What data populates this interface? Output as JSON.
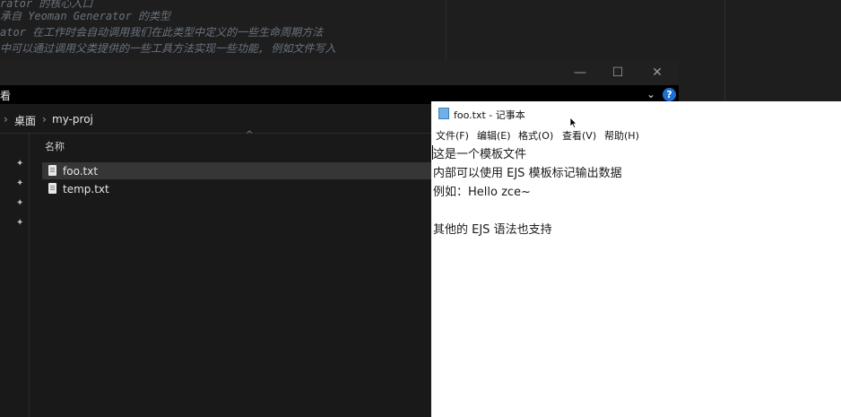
{
  "editor": {
    "lines": [
      "rator 的核心入口",
      "承自 Yeoman Generator 的类型",
      "ator 在工作时会自动调用我们在此类型中定义的一些生命周期方法",
      "中可以通过调用父类提供的一些工具方法实现一些功能, 例如文件写入"
    ]
  },
  "explorer": {
    "window_controls": {
      "minimize": "—",
      "maximize": "☐",
      "close": "✕"
    },
    "ribbon": {
      "label": "看",
      "expand": "⌄",
      "help": "?"
    },
    "breadcrumb": {
      "sep": "›",
      "items": [
        "桌面",
        "my-proj"
      ]
    },
    "columns": {
      "name": "名称",
      "sort": "^"
    },
    "files": [
      {
        "name": "foo.txt",
        "selected": true
      },
      {
        "name": "temp.txt",
        "selected": false
      }
    ],
    "pin_glyph": "✦"
  },
  "notepad": {
    "title": "foo.txt - 记事本",
    "menu": [
      "文件(F)",
      "编辑(E)",
      "格式(O)",
      "查看(V)",
      "帮助(H)"
    ],
    "content": [
      "这是一个模板文件",
      "内部可以使用 EJS 模板标记输出数据",
      "例如：Hello zce~",
      "",
      "其他的 EJS 语法也支持"
    ]
  },
  "colors": {
    "editor_bg": "#1e1e1e",
    "explorer_bg": "#191919",
    "selected_row": "#363636",
    "help_blue": "#1f6fd1"
  }
}
